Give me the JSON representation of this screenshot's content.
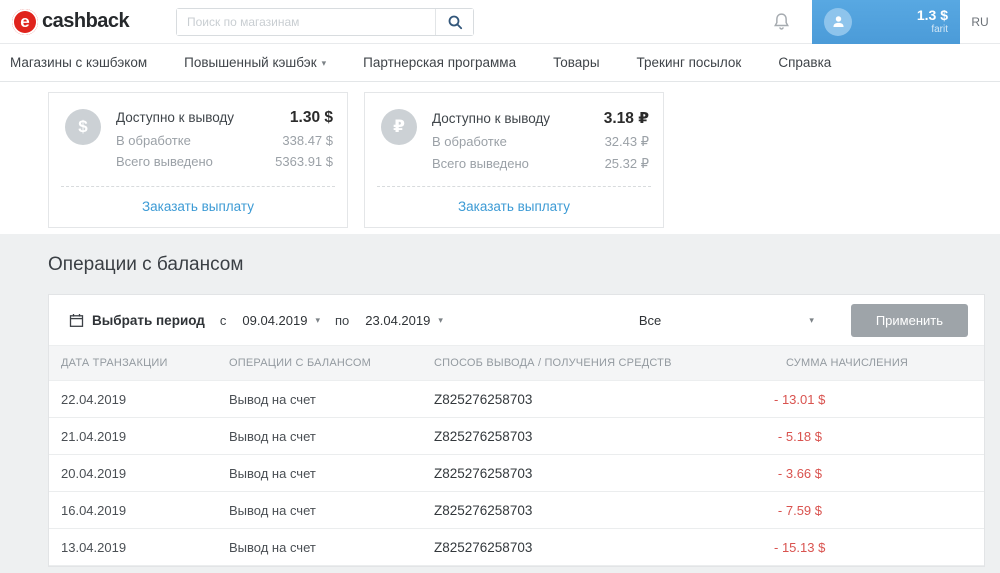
{
  "colors": {
    "accent_blue": "#4b9bd8",
    "logo_red": "#e0231c",
    "amount_red": "#d9534f",
    "link_blue": "#3d9bd5"
  },
  "header": {
    "logo_text": "cashback",
    "search_placeholder": "Поиск по магазинам",
    "user_balance": "1.3 $",
    "username": "farit",
    "lang": "RU"
  },
  "nav": {
    "items": [
      {
        "label": "Магазины с кэшбэком",
        "has_dropdown": false
      },
      {
        "label": "Повышенный кэшбэк",
        "has_dropdown": true
      },
      {
        "label": "Партнерская программа",
        "has_dropdown": false
      },
      {
        "label": "Товары",
        "has_dropdown": false
      },
      {
        "label": "Трекинг посылок",
        "has_dropdown": false
      },
      {
        "label": "Справка",
        "has_dropdown": false
      }
    ]
  },
  "balance_cards": [
    {
      "symbol": "$",
      "rows": [
        {
          "label": "Доступно к выводу",
          "value": "1.30 $"
        },
        {
          "label": "В обработке",
          "value": "338.47 $"
        },
        {
          "label": "Всего выведено",
          "value": "5363.91 $"
        }
      ],
      "action": "Заказать выплату"
    },
    {
      "symbol": "₽",
      "rows": [
        {
          "label": "Доступно к выводу",
          "value": "3.18 ₽"
        },
        {
          "label": "В обработке",
          "value": "32.43 ₽"
        },
        {
          "label": "Всего выведено",
          "value": "25.32 ₽"
        }
      ],
      "action": "Заказать выплату"
    }
  ],
  "section_title": "Операции с балансом",
  "filter": {
    "period_label": "Выбрать период",
    "from_label": "с",
    "from_value": "09.04.2019",
    "to_label": "по",
    "to_value": "23.04.2019",
    "type_value": "Все",
    "apply_label": "Применить"
  },
  "table": {
    "headers": [
      "ДАТА ТРАНЗАКЦИИ",
      "ОПЕРАЦИИ С БАЛАНСОМ",
      "СПОСОБ ВЫВОДА / ПОЛУЧЕНИЯ СРЕДСТВ",
      "СУММА НАЧИСЛЕНИЯ"
    ],
    "rows": [
      {
        "date": "22.04.2019",
        "operation": "Вывод на счет",
        "method": "Z825276258703",
        "amount": "- 13.01 $"
      },
      {
        "date": "21.04.2019",
        "operation": "Вывод на счет",
        "method": "Z825276258703",
        "amount": "- 5.18 $"
      },
      {
        "date": "20.04.2019",
        "operation": "Вывод на счет",
        "method": "Z825276258703",
        "amount": "- 3.66 $"
      },
      {
        "date": "16.04.2019",
        "operation": "Вывод на счет",
        "method": "Z825276258703",
        "amount": "- 7.59 $"
      },
      {
        "date": "13.04.2019",
        "operation": "Вывод на счет",
        "method": "Z825276258703",
        "amount": "- 15.13 $"
      }
    ]
  }
}
